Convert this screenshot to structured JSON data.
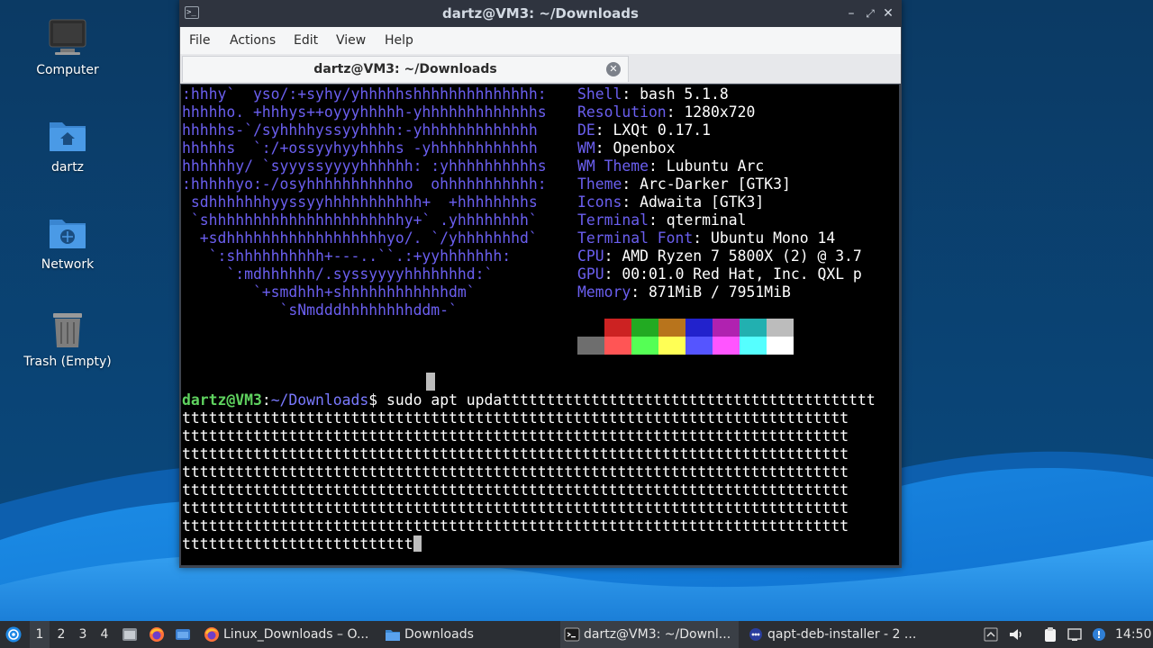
{
  "desktop": {
    "icons": [
      {
        "label": "Computer",
        "icon": "computer-icon"
      },
      {
        "label": "dartz",
        "icon": "home-folder-icon"
      },
      {
        "label": "Network",
        "icon": "network-folder-icon"
      },
      {
        "label": "Trash (Empty)",
        "icon": "trash-icon"
      }
    ]
  },
  "window": {
    "title": "dartz@VM3: ~/Downloads",
    "menu": [
      "File",
      "Actions",
      "Edit",
      "View",
      "Help"
    ],
    "tab_title": "dartz@VM3: ~/Downloads"
  },
  "terminal": {
    "logo_lines": [
      ":hhhy`  yso/:+syhy/yhhhhhshhhhhhhhhhhhhh:",
      "hhhhho. +hhhys++oyyyhhhhh-yhhhhhhhhhhhhhs",
      "hhhhhs-`/syhhhhyssyyhhhh:-yhhhhhhhhhhhhh",
      "hhhhhs  `:/+ossyyhyyhhhhs -yhhhhhhhhhhhh",
      "hhhhhhy/ `syyyssyyyyhhhhhh: :yhhhhhhhhhhs",
      ":hhhhhyo:-/osyhhhhhhhhhhho  ohhhhhhhhhhh:",
      " sdhhhhhhhyyssyyhhhhhhhhhhh+  +hhhhhhhhs",
      " `shhhhhhhhhhhhhhhhhhhhhhy+` .yhhhhhhhh`",
      "  +sdhhhhhhhhhhhhhhhhhhyo/. `/yhhhhhhhd`",
      "   `:shhhhhhhhhh+---..``.:+yyhhhhhhh:",
      "     `:mdhhhhhh/.syssyyyyhhhhhhhd:`",
      "        `+smdhhh+shhhhhhhhhhhhdm`",
      "           `sNmdddhhhhhhhhddm-`"
    ],
    "info": [
      {
        "key": "Shell",
        "value": "bash 5.1.8"
      },
      {
        "key": "Resolution",
        "value": "1280x720"
      },
      {
        "key": "DE",
        "value": "LXQt 0.17.1"
      },
      {
        "key": "WM",
        "value": "Openbox"
      },
      {
        "key": "WM Theme",
        "value": "Lubuntu Arc"
      },
      {
        "key": "Theme",
        "value": "Arc-Darker [GTK3]"
      },
      {
        "key": "Icons",
        "value": "Adwaita [GTK3]"
      },
      {
        "key": "Terminal",
        "value": "qterminal"
      },
      {
        "key": "Terminal Font",
        "value": "Ubuntu Mono 14"
      },
      {
        "key": "CPU",
        "value": "AMD Ryzen 7 5800X (2) @ 3.7"
      },
      {
        "key": "GPU",
        "value": "00:01.0 Red Hat, Inc. QXL p"
      },
      {
        "key": "Memory",
        "value": "871MiB / 7951MiB"
      }
    ],
    "palette_top": [
      "#000000",
      "#cc2222",
      "#22aa22",
      "#b8741c",
      "#2222cc",
      "#b022b0",
      "#22b0b0",
      "#bcbcbc"
    ],
    "palette_bottom": [
      "#6e6e6e",
      "#ff5555",
      "#55ff55",
      "#ffff55",
      "#5555ff",
      "#ff55ff",
      "#55ffff",
      "#ffffff"
    ],
    "prompt_user": "dartz@VM3",
    "prompt_path": "~/Downloads",
    "prompt_symbol": "$",
    "command_first": "sudo apt updatttttttttttttttttttttttttttttttttttttttttt",
    "command_lines": [
      "ttttttttttttttttttttttttttttttttttttttttttttttttttttttttttttttttttttttttttt",
      "ttttttttttttttttttttttttttttttttttttttttttttttttttttttttttttttttttttttttttt",
      "ttttttttttttttttttttttttttttttttttttttttttttttttttttttttttttttttttttttttttt",
      "ttttttttttttttttttttttttttttttttttttttttttttttttttttttttttttttttttttttttttt",
      "ttttttttttttttttttttttttttttttttttttttttttttttttttttttttttttttttttttttttttt",
      "ttttttttttttttttttttttttttttttttttttttttttttttttttttttttttttttttttttttttttt",
      "ttttttttttttttttttttttttttttttttttttttttttttttttttttttttttttttttttttttttttt"
    ],
    "command_last": "tttttttttttttttttttttttttt"
  },
  "taskbar": {
    "workspaces": [
      "1",
      "2",
      "3",
      "4"
    ],
    "active_workspace": "1",
    "tasks": [
      {
        "label": "Linux_Downloads – O...",
        "icon": "firefox-icon"
      },
      {
        "label": "Downloads",
        "icon": "folder-icon"
      },
      {
        "label": "dartz@VM3: ~/Downl...",
        "icon": "terminal-icon"
      },
      {
        "label": "qapt-deb-installer - 2 ...",
        "icon": "installer-icon"
      }
    ],
    "clock": "14:50"
  }
}
